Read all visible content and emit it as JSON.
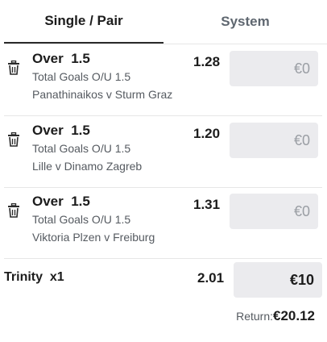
{
  "tabs": [
    {
      "label": "Single / Pair",
      "active": true
    },
    {
      "label": "System",
      "active": false
    }
  ],
  "bets": [
    {
      "selection": "Over  1.5",
      "market": "Total Goals O/U 1.5",
      "event": "Panathinaikos v Sturm Graz",
      "odds": "1.28",
      "stake_placeholder": "€0"
    },
    {
      "selection": "Over  1.5",
      "market": "Total Goals O/U 1.5",
      "event": "Lille v Dinamo Zagreb",
      "odds": "1.20",
      "stake_placeholder": "€0"
    },
    {
      "selection": "Over  1.5",
      "market": "Total Goals O/U 1.5",
      "event": "Viktoria Plzen v Freiburg",
      "odds": "1.31",
      "stake_placeholder": "€0"
    }
  ],
  "combo": {
    "label": "Trinity  x1",
    "odds": "2.01",
    "stake": "€10",
    "return_label": "Return:",
    "return_value": "€20.12"
  },
  "icons": {
    "remove": "trash-icon"
  },
  "colors": {
    "stake_bg": "#ebebee",
    "active_tab_underline": "#2b2b2b",
    "muted_text": "#555a60"
  }
}
